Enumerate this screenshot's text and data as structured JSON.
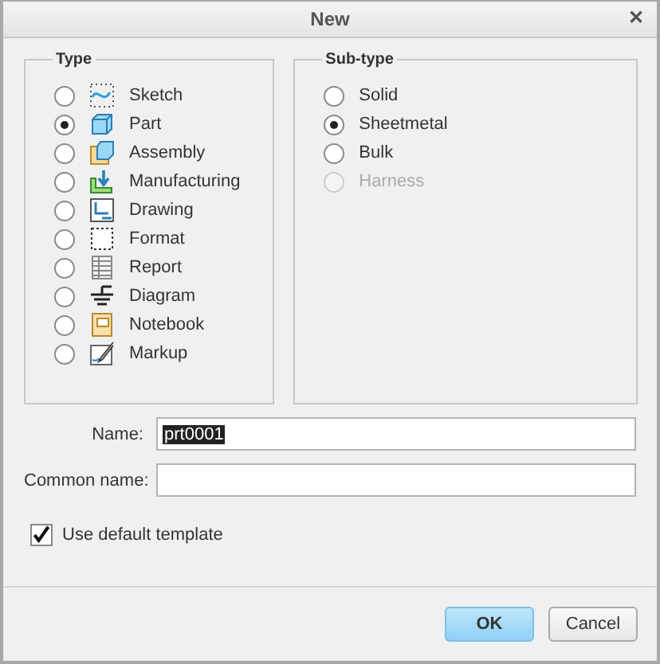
{
  "window": {
    "title": "New",
    "close": "✕"
  },
  "type_group": {
    "title": "Type",
    "items": [
      {
        "label": "Sketch",
        "kind": "sketch",
        "selected": false
      },
      {
        "label": "Part",
        "kind": "part",
        "selected": true
      },
      {
        "label": "Assembly",
        "kind": "assembly",
        "selected": false
      },
      {
        "label": "Manufacturing",
        "kind": "manufacturing",
        "selected": false
      },
      {
        "label": "Drawing",
        "kind": "drawing",
        "selected": false
      },
      {
        "label": "Format",
        "kind": "format",
        "selected": false
      },
      {
        "label": "Report",
        "kind": "report",
        "selected": false
      },
      {
        "label": "Diagram",
        "kind": "diagram",
        "selected": false
      },
      {
        "label": "Notebook",
        "kind": "notebook",
        "selected": false
      },
      {
        "label": "Markup",
        "kind": "markup",
        "selected": false
      }
    ]
  },
  "subtype_group": {
    "title": "Sub-type",
    "items": [
      {
        "label": "Solid",
        "selected": false,
        "disabled": false
      },
      {
        "label": "Sheetmetal",
        "selected": true,
        "disabled": false
      },
      {
        "label": "Bulk",
        "selected": false,
        "disabled": false
      },
      {
        "label": "Harness",
        "selected": false,
        "disabled": true
      }
    ]
  },
  "fields": [
    {
      "label": "Name:",
      "value": "prt0001",
      "text_selected": true
    },
    {
      "label": "Common name:"
    }
  ],
  "use_default_template": {
    "label": "Use default template",
    "checked": true
  },
  "buttons": [
    {
      "label": "OK",
      "default": true
    },
    {
      "label": "Cancel",
      "default": false
    }
  ]
}
